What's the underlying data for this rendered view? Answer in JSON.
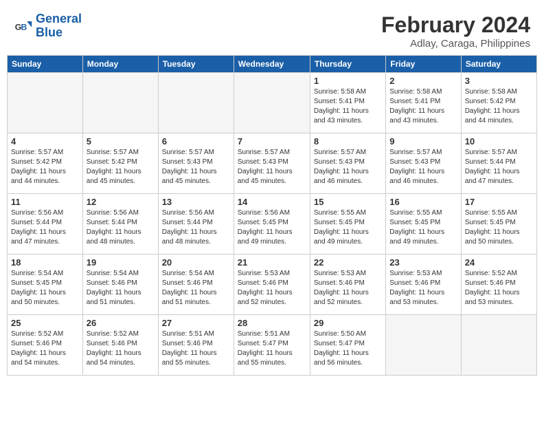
{
  "logo": {
    "line1": "General",
    "line2": "Blue"
  },
  "title": "February 2024",
  "location": "Adlay, Caraga, Philippines",
  "headers": [
    "Sunday",
    "Monday",
    "Tuesday",
    "Wednesday",
    "Thursday",
    "Friday",
    "Saturday"
  ],
  "weeks": [
    [
      {
        "day": "",
        "info": ""
      },
      {
        "day": "",
        "info": ""
      },
      {
        "day": "",
        "info": ""
      },
      {
        "day": "",
        "info": ""
      },
      {
        "day": "1",
        "info": "Sunrise: 5:58 AM\nSunset: 5:41 PM\nDaylight: 11 hours\nand 43 minutes."
      },
      {
        "day": "2",
        "info": "Sunrise: 5:58 AM\nSunset: 5:41 PM\nDaylight: 11 hours\nand 43 minutes."
      },
      {
        "day": "3",
        "info": "Sunrise: 5:58 AM\nSunset: 5:42 PM\nDaylight: 11 hours\nand 44 minutes."
      }
    ],
    [
      {
        "day": "4",
        "info": "Sunrise: 5:57 AM\nSunset: 5:42 PM\nDaylight: 11 hours\nand 44 minutes."
      },
      {
        "day": "5",
        "info": "Sunrise: 5:57 AM\nSunset: 5:42 PM\nDaylight: 11 hours\nand 45 minutes."
      },
      {
        "day": "6",
        "info": "Sunrise: 5:57 AM\nSunset: 5:43 PM\nDaylight: 11 hours\nand 45 minutes."
      },
      {
        "day": "7",
        "info": "Sunrise: 5:57 AM\nSunset: 5:43 PM\nDaylight: 11 hours\nand 45 minutes."
      },
      {
        "day": "8",
        "info": "Sunrise: 5:57 AM\nSunset: 5:43 PM\nDaylight: 11 hours\nand 46 minutes."
      },
      {
        "day": "9",
        "info": "Sunrise: 5:57 AM\nSunset: 5:43 PM\nDaylight: 11 hours\nand 46 minutes."
      },
      {
        "day": "10",
        "info": "Sunrise: 5:57 AM\nSunset: 5:44 PM\nDaylight: 11 hours\nand 47 minutes."
      }
    ],
    [
      {
        "day": "11",
        "info": "Sunrise: 5:56 AM\nSunset: 5:44 PM\nDaylight: 11 hours\nand 47 minutes."
      },
      {
        "day": "12",
        "info": "Sunrise: 5:56 AM\nSunset: 5:44 PM\nDaylight: 11 hours\nand 48 minutes."
      },
      {
        "day": "13",
        "info": "Sunrise: 5:56 AM\nSunset: 5:44 PM\nDaylight: 11 hours\nand 48 minutes."
      },
      {
        "day": "14",
        "info": "Sunrise: 5:56 AM\nSunset: 5:45 PM\nDaylight: 11 hours\nand 49 minutes."
      },
      {
        "day": "15",
        "info": "Sunrise: 5:55 AM\nSunset: 5:45 PM\nDaylight: 11 hours\nand 49 minutes."
      },
      {
        "day": "16",
        "info": "Sunrise: 5:55 AM\nSunset: 5:45 PM\nDaylight: 11 hours\nand 49 minutes."
      },
      {
        "day": "17",
        "info": "Sunrise: 5:55 AM\nSunset: 5:45 PM\nDaylight: 11 hours\nand 50 minutes."
      }
    ],
    [
      {
        "day": "18",
        "info": "Sunrise: 5:54 AM\nSunset: 5:45 PM\nDaylight: 11 hours\nand 50 minutes."
      },
      {
        "day": "19",
        "info": "Sunrise: 5:54 AM\nSunset: 5:46 PM\nDaylight: 11 hours\nand 51 minutes."
      },
      {
        "day": "20",
        "info": "Sunrise: 5:54 AM\nSunset: 5:46 PM\nDaylight: 11 hours\nand 51 minutes."
      },
      {
        "day": "21",
        "info": "Sunrise: 5:53 AM\nSunset: 5:46 PM\nDaylight: 11 hours\nand 52 minutes."
      },
      {
        "day": "22",
        "info": "Sunrise: 5:53 AM\nSunset: 5:46 PM\nDaylight: 11 hours\nand 52 minutes."
      },
      {
        "day": "23",
        "info": "Sunrise: 5:53 AM\nSunset: 5:46 PM\nDaylight: 11 hours\nand 53 minutes."
      },
      {
        "day": "24",
        "info": "Sunrise: 5:52 AM\nSunset: 5:46 PM\nDaylight: 11 hours\nand 53 minutes."
      }
    ],
    [
      {
        "day": "25",
        "info": "Sunrise: 5:52 AM\nSunset: 5:46 PM\nDaylight: 11 hours\nand 54 minutes."
      },
      {
        "day": "26",
        "info": "Sunrise: 5:52 AM\nSunset: 5:46 PM\nDaylight: 11 hours\nand 54 minutes."
      },
      {
        "day": "27",
        "info": "Sunrise: 5:51 AM\nSunset: 5:46 PM\nDaylight: 11 hours\nand 55 minutes."
      },
      {
        "day": "28",
        "info": "Sunrise: 5:51 AM\nSunset: 5:47 PM\nDaylight: 11 hours\nand 55 minutes."
      },
      {
        "day": "29",
        "info": "Sunrise: 5:50 AM\nSunset: 5:47 PM\nDaylight: 11 hours\nand 56 minutes."
      },
      {
        "day": "",
        "info": ""
      },
      {
        "day": "",
        "info": ""
      }
    ]
  ]
}
